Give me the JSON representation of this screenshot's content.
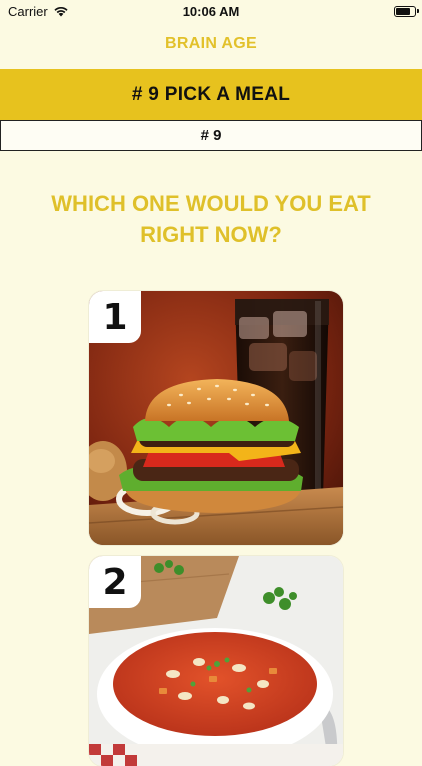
{
  "status_bar": {
    "carrier": "Carrier",
    "time": "10:06 AM",
    "battery_level": 0.85
  },
  "app": {
    "title": "BRAIN AGE"
  },
  "header": {
    "title": "# 9 PICK A MEAL",
    "subtitle": "# 9"
  },
  "question": "WHICH ONE WOULD YOU EAT RIGHT NOW?",
  "options": [
    {
      "number": "1",
      "image": "burger-and-cola-image"
    },
    {
      "number": "2",
      "image": "vegetable-soup-image"
    }
  ],
  "colors": {
    "background": "#FCFAE2",
    "accent": "#E7C21E",
    "accent_text": "#E2C12B"
  }
}
